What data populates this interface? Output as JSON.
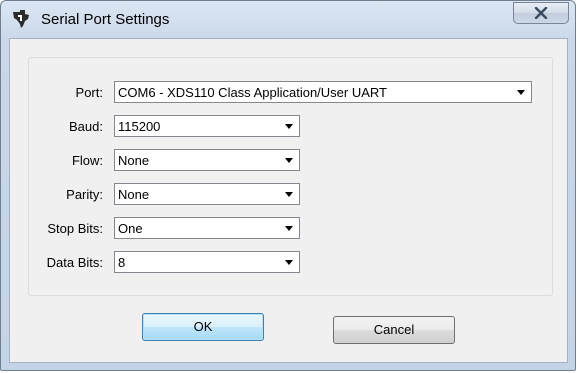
{
  "window": {
    "title": "Serial Port Settings"
  },
  "form": {
    "port": {
      "label": "Port:",
      "value": "COM6 - XDS110 Class Application/User UART"
    },
    "baud": {
      "label": "Baud:",
      "value": "115200"
    },
    "flow": {
      "label": "Flow:",
      "value": "None"
    },
    "parity": {
      "label": "Parity:",
      "value": "None"
    },
    "stop_bits": {
      "label": "Stop Bits:",
      "value": "One"
    },
    "data_bits": {
      "label": "Data Bits:",
      "value": "8"
    }
  },
  "buttons": {
    "ok": "OK",
    "cancel": "Cancel"
  },
  "icons": {
    "app": "texas-instruments-logo-icon",
    "close": "close-icon",
    "dropdown": "chevron-down-icon"
  },
  "colors": {
    "ti_red": "#c8102e",
    "close_x": "#3a4a60",
    "default_button_border": "#3c7fb1"
  }
}
